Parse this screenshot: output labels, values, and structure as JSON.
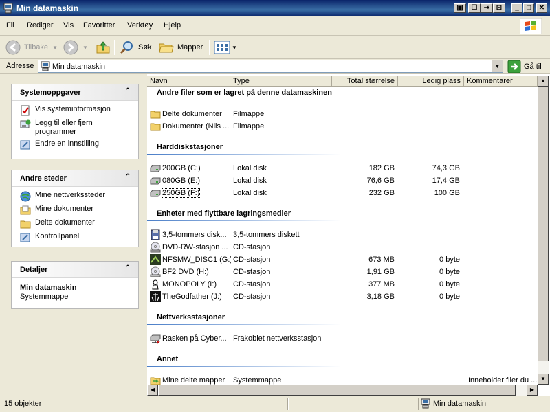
{
  "window": {
    "title": "Min datamaskin"
  },
  "menu": [
    "Fil",
    "Rediger",
    "Vis",
    "Favoritter",
    "Verktøy",
    "Hjelp"
  ],
  "toolbar": {
    "back": "Tilbake",
    "search": "Søk",
    "folders": "Mapper"
  },
  "address": {
    "label": "Adresse",
    "value": "Min datamaskin",
    "go": "Gå til"
  },
  "tasks": {
    "system": {
      "title": "Systemoppgaver",
      "items": [
        "Vis systeminformasjon",
        "Legg til eller fjern programmer",
        "Endre en innstilling"
      ]
    },
    "places": {
      "title": "Andre steder",
      "items": [
        "Mine nettverkssteder",
        "Mine dokumenter",
        "Delte dokumenter",
        "Kontrollpanel"
      ]
    },
    "details": {
      "title": "Detaljer",
      "name": "Min datamaskin",
      "type": "Systemmappe"
    }
  },
  "columns": {
    "name": "Navn",
    "type": "Type",
    "total": "Total størrelse",
    "free": "Ledig plass",
    "comments": "Kommentarer"
  },
  "groups": {
    "files": {
      "title": "Andre filer som er lagret på denne datamaskinen",
      "rows": [
        {
          "name": "Delte dokumenter",
          "type": "Filmappe",
          "total": "",
          "free": "",
          "icon": "folder-icon"
        },
        {
          "name": "Dokumenter (Nils ...",
          "type": "Filmappe",
          "total": "",
          "free": "",
          "icon": "folder-icon"
        }
      ]
    },
    "hdd": {
      "title": "Harddiskstasjoner",
      "rows": [
        {
          "name": "200GB (C:)",
          "type": "Lokal disk",
          "total": "182 GB",
          "free": "74,3 GB",
          "icon": "hard-drive-icon"
        },
        {
          "name": "080GB (E:)",
          "type": "Lokal disk",
          "total": "76,6 GB",
          "free": "17,4 GB",
          "icon": "hard-drive-icon"
        },
        {
          "name": "250GB (F:)",
          "type": "Lokal disk",
          "total": "232 GB",
          "free": "100 GB",
          "icon": "hard-drive-icon"
        }
      ]
    },
    "removable": {
      "title": "Enheter med flyttbare lagringsmedier",
      "rows": [
        {
          "name": "3,5-tommers disk...",
          "type": "3,5-tommers diskett",
          "total": "",
          "free": "",
          "icon": "floppy-drive-icon"
        },
        {
          "name": "DVD-RW-stasjon ...",
          "type": "CD-stasjon",
          "total": "",
          "free": "",
          "icon": "cd-drive-icon"
        },
        {
          "name": "NFSMW_DISC1 (G:)",
          "type": "CD-stasjon",
          "total": "673 MB",
          "free": "0 byte",
          "icon": "game-disc-icon"
        },
        {
          "name": "BF2 DVD (H:)",
          "type": "CD-stasjon",
          "total": "1,91 GB",
          "free": "0 byte",
          "icon": "cd-drive-icon"
        },
        {
          "name": "MONOPOLY (I:)",
          "type": "CD-stasjon",
          "total": "377 MB",
          "free": "0 byte",
          "icon": "monopoly-disc-icon"
        },
        {
          "name": "TheGodfather (J:)",
          "type": "CD-stasjon",
          "total": "3,18 GB",
          "free": "0 byte",
          "icon": "godfather-disc-icon"
        }
      ]
    },
    "network": {
      "title": "Nettverksstasjoner",
      "rows": [
        {
          "name": "Rasken på Cyber...",
          "type": "Frakoblet nettverksstasjon",
          "total": "",
          "free": "",
          "icon": "network-drive-icon"
        }
      ]
    },
    "other": {
      "title": "Annet",
      "rows": [
        {
          "name": "Mine delte mapper",
          "type": "Systemmappe",
          "total": "",
          "free": "",
          "comment": "Inneholder filer du ...",
          "icon": "shared-folder-icon"
        }
      ]
    }
  },
  "status": {
    "count": "15 objekter",
    "location": "Min datamaskin"
  },
  "colors": {
    "titlebar": "#0a246a",
    "chrome": "#ece9d8",
    "groupline": "#4a7ec8"
  }
}
